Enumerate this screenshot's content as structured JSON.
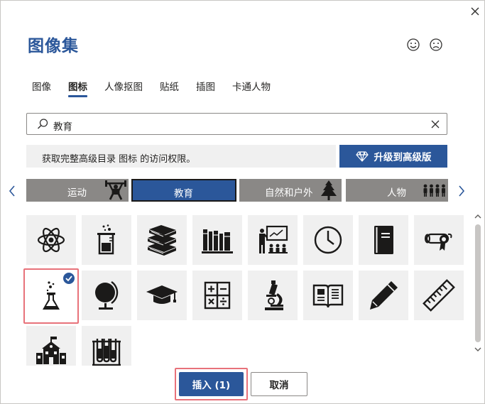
{
  "dialog": {
    "title": "图像集"
  },
  "tabs": [
    {
      "label": "图像",
      "active": false
    },
    {
      "label": "图标",
      "active": true
    },
    {
      "label": "人像抠图",
      "active": false
    },
    {
      "label": "贴纸",
      "active": false
    },
    {
      "label": "插图",
      "active": false
    },
    {
      "label": "卡通人物",
      "active": false
    }
  ],
  "search": {
    "value": "教育"
  },
  "upsell": {
    "message": "获取完整高级目录 图标 的访问权限。",
    "upgrade_label": "升级到高级版"
  },
  "categories": [
    {
      "label": "运动",
      "icon": "weightlifter-icon",
      "active": false
    },
    {
      "label": "教育",
      "icon": "",
      "active": true
    },
    {
      "label": "自然和户外",
      "icon": "pine-tree-icon",
      "active": false
    },
    {
      "label": "人物",
      "icon": "people-group-icon",
      "active": false
    }
  ],
  "icons": [
    {
      "name": "atom-icon",
      "selected": false
    },
    {
      "name": "beaker-icon",
      "selected": false
    },
    {
      "name": "book-stack-icon",
      "selected": false
    },
    {
      "name": "bookshelf-icon",
      "selected": false
    },
    {
      "name": "classroom-teacher-icon",
      "selected": false
    },
    {
      "name": "clock-icon",
      "selected": false
    },
    {
      "name": "notebook-icon",
      "selected": false
    },
    {
      "name": "diploma-icon",
      "selected": false
    },
    {
      "name": "erlenmeyer-flask-icon",
      "selected": true
    },
    {
      "name": "globe-icon",
      "selected": false
    },
    {
      "name": "graduation-cap-icon",
      "selected": false
    },
    {
      "name": "calculator-symbols-icon",
      "selected": false
    },
    {
      "name": "microscope-icon",
      "selected": false
    },
    {
      "name": "open-book-icon",
      "selected": false
    },
    {
      "name": "pencil-icon",
      "selected": false
    },
    {
      "name": "ruler-icon",
      "selected": false
    },
    {
      "name": "school-building-icon",
      "selected": false
    },
    {
      "name": "test-tubes-icon",
      "selected": false
    }
  ],
  "footer": {
    "insert_label": "插入 (1)",
    "cancel_label": "取消"
  },
  "colors": {
    "accent": "#2b579a",
    "category_inactive": "#8a8886",
    "tile_background": "#f0f0f0",
    "selection_highlight": "#e8727a"
  }
}
